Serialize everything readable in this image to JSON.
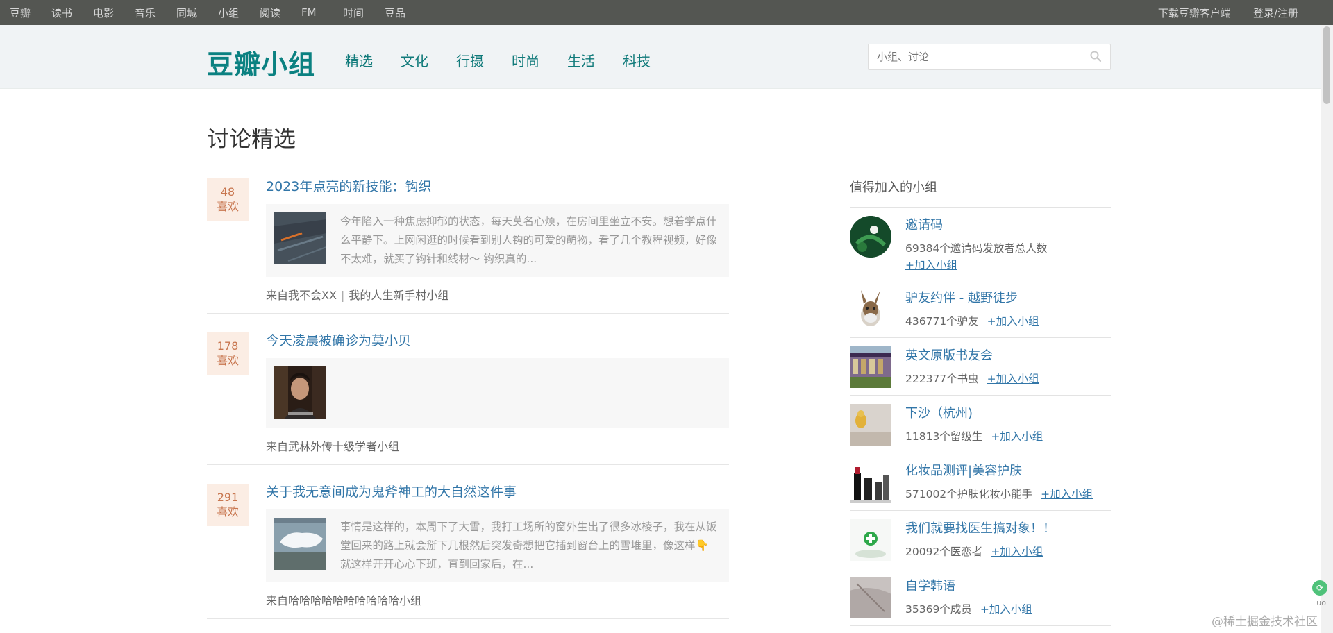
{
  "global_nav": {
    "left": [
      "豆瓣",
      "读书",
      "电影",
      "音乐",
      "同城",
      "小组",
      "阅读",
      "FM",
      "时间",
      "豆品"
    ],
    "right": [
      "下载豆瓣客户端",
      "登录/注册"
    ]
  },
  "header": {
    "logo": "豆瓣小组",
    "nav": [
      "精选",
      "文化",
      "行摄",
      "时尚",
      "生活",
      "科技"
    ],
    "search_placeholder": "小组、讨论",
    "search_icon": "search-icon"
  },
  "page_title": "讨论精选",
  "topics": [
    {
      "likes": "48",
      "likes_label": "喜欢",
      "title": "2023年点亮的新技能：钩织",
      "excerpt": "今年陷入一种焦虑抑郁的状态，每天莫名心烦，在房间里坐立不安。想着学点什么平静下。上网闲逛的时候看到别人钩的可爱的萌物，看了几个教程视频，好像不太难，就买了钩针和线材～ 钩织真的...",
      "from_prefix": "来自",
      "from_user": "我不会XX",
      "from_group": "我的人生新手村小组"
    },
    {
      "likes": "178",
      "likes_label": "喜欢",
      "title": "今天凌晨被确诊为莫小贝",
      "excerpt": "",
      "from_prefix": "来自",
      "from_group": "武林外传十级学者小组"
    },
    {
      "likes": "291",
      "likes_label": "喜欢",
      "title": "关于我无意间成为鬼斧神工的大自然这件事",
      "excerpt": "事情是这样的，本周下了大雪，我打工场所的窗外生出了很多冰棱子，我在从饭堂回来的路上就会掰下几根然后突发奇想把它插到窗台上的雪堆里，像这样👇 就这样开开心心下班，直到回家后，在...",
      "from_prefix": "来自",
      "from_group": "哈哈哈哈哈哈哈哈哈哈小组"
    }
  ],
  "sidebar": {
    "title": "值得加入的小组",
    "join_label": "+加入小组",
    "groups": [
      {
        "name": "邀请码",
        "meta": "69384个邀请码发放者总人数"
      },
      {
        "name": "驴友约伴 - 越野徒步",
        "meta": "436771个驴友"
      },
      {
        "name": "英文原版书友会",
        "meta": "222377个书虫"
      },
      {
        "name": "下沙（杭州)",
        "meta": "11813个留级生"
      },
      {
        "name": "化妆品测评|美容护肤",
        "meta": "571002个护肤化妆小能手"
      },
      {
        "name": "我们就要找医生搞对象！！",
        "meta": "20092个医恋者"
      },
      {
        "name": "自学韩语",
        "meta": "35369个成员"
      }
    ]
  },
  "watermark": "@稀土掘金技术社区",
  "float_text": "uo"
}
